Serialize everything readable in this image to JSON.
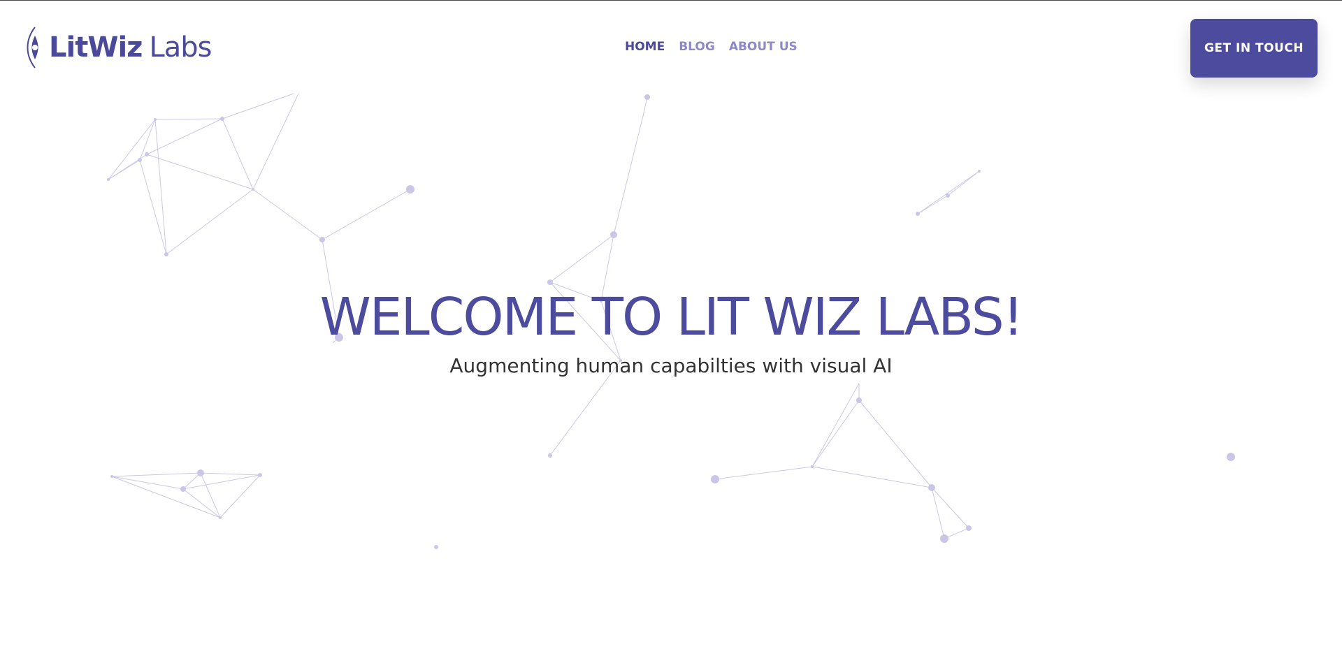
{
  "brand": {
    "name_strong": "LitWiz",
    "name_light": "Labs",
    "color": "#4b4a9a"
  },
  "nav": {
    "items": [
      {
        "label": "HOME",
        "active": true
      },
      {
        "label": "BLOG",
        "active": false
      },
      {
        "label": "ABOUT US",
        "active": false
      }
    ]
  },
  "cta": {
    "label": "GET IN TOUCH",
    "color": "#4c4b9d"
  },
  "hero": {
    "title": "WELCOME TO LIT WIZ LABS!",
    "subtitle": "Augmenting human capabilties with visual AI"
  },
  "background": {
    "pattern": "particle-network",
    "accent": "#8a86c6"
  }
}
